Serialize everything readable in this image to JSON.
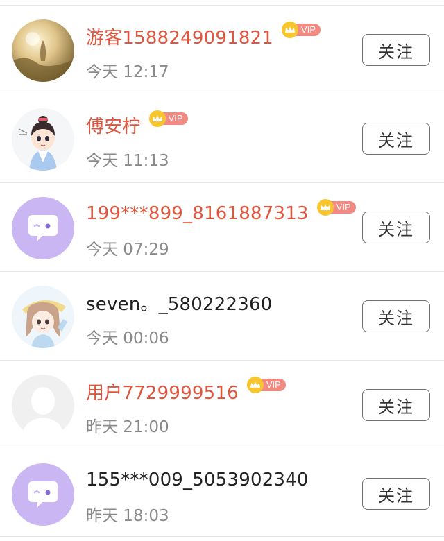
{
  "follow_label": "关注",
  "vip_label": "VIP",
  "users": [
    {
      "name": "游客1588249091821",
      "vip": true,
      "time": "今天 12:17",
      "avatar": "photo-avatar"
    },
    {
      "name": "傅安柠",
      "vip": true,
      "time": "今天 11:13",
      "avatar": "cartoon-boy-avatar"
    },
    {
      "name": "199***899_8161887313",
      "vip": true,
      "time": "今天 07:29",
      "avatar": "default-chat-avatar"
    },
    {
      "name": "seven。_580222360",
      "vip": false,
      "time": "今天 00:06",
      "avatar": "anime-girl-avatar"
    },
    {
      "name": "用户7729999516",
      "vip": true,
      "time": "昨天 21:00",
      "avatar": "silhouette-avatar"
    },
    {
      "name": "155***009_5053902340",
      "vip": false,
      "time": "昨天 18:03",
      "avatar": "default-chat-avatar"
    }
  ],
  "colors": {
    "vip_name": "#e2543b",
    "normal_name": "#222222",
    "time": "#8a8a8a",
    "vip_badge": "#f08a83",
    "crown": "#f7c52e",
    "default_avatar_bg": "#c9b6f2"
  }
}
